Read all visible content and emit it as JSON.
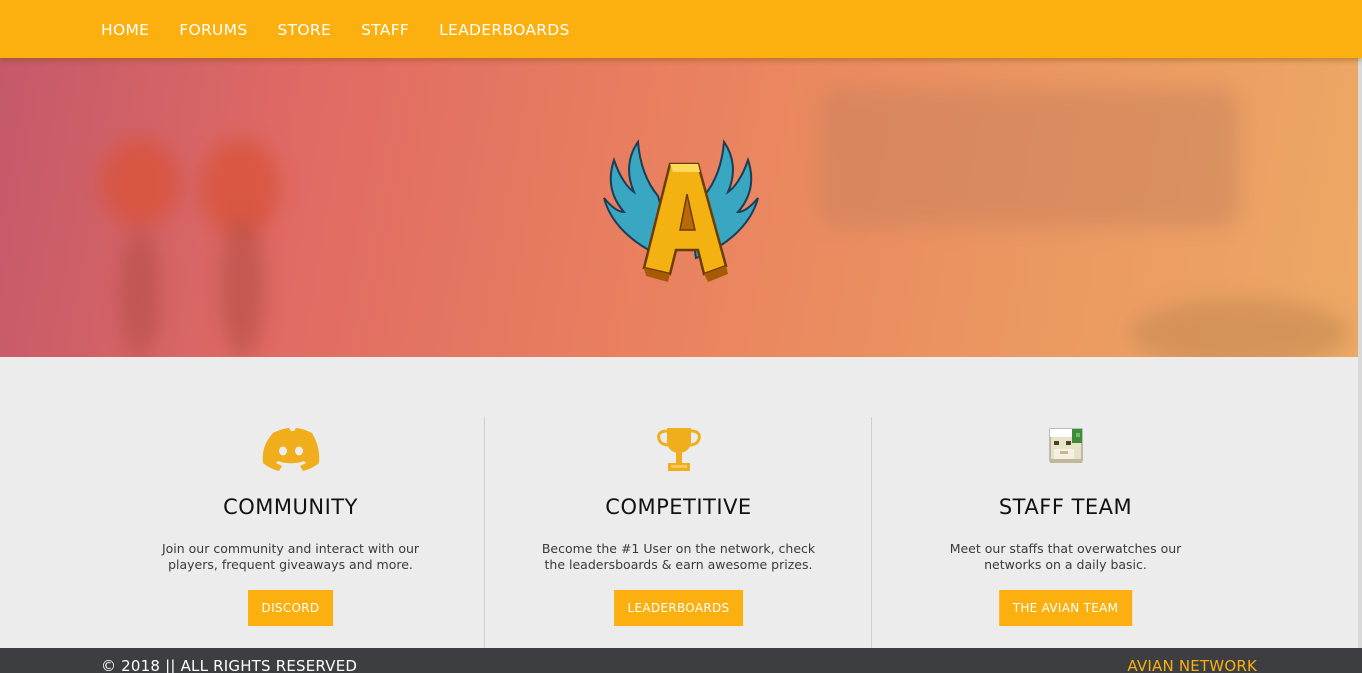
{
  "nav": {
    "items": [
      {
        "label": "HOME"
      },
      {
        "label": "FORUMS"
      },
      {
        "label": "STORE"
      },
      {
        "label": "STAFF"
      },
      {
        "label": "LEADERBOARDS"
      }
    ]
  },
  "hero": {
    "logo_letter": "A"
  },
  "features": [
    {
      "icon": "discord-icon",
      "title": "COMMUNITY",
      "text": "Join our community and interact with our players, frequent giveaways and more.",
      "button": "DISCORD"
    },
    {
      "icon": "trophy-icon",
      "title": "COMPETITIVE",
      "text": "Become the #1 User on the network, check the leadersboards & earn awesome prizes.",
      "button": "LEADERBOARDS"
    },
    {
      "icon": "player-head-icon",
      "title": "STAFF TEAM",
      "text": "Meet our staffs that overwatches our networks on a daily basic.",
      "button": "THE AVIAN TEAM"
    }
  ],
  "footer": {
    "copyright": "© 2018 || ALL RIGHTS RESERVED",
    "brand": "AVIAN NETWORK"
  },
  "colors": {
    "accent": "#fbb00f",
    "footer_bg": "#3c3e41",
    "page_bg": "#ececec"
  }
}
